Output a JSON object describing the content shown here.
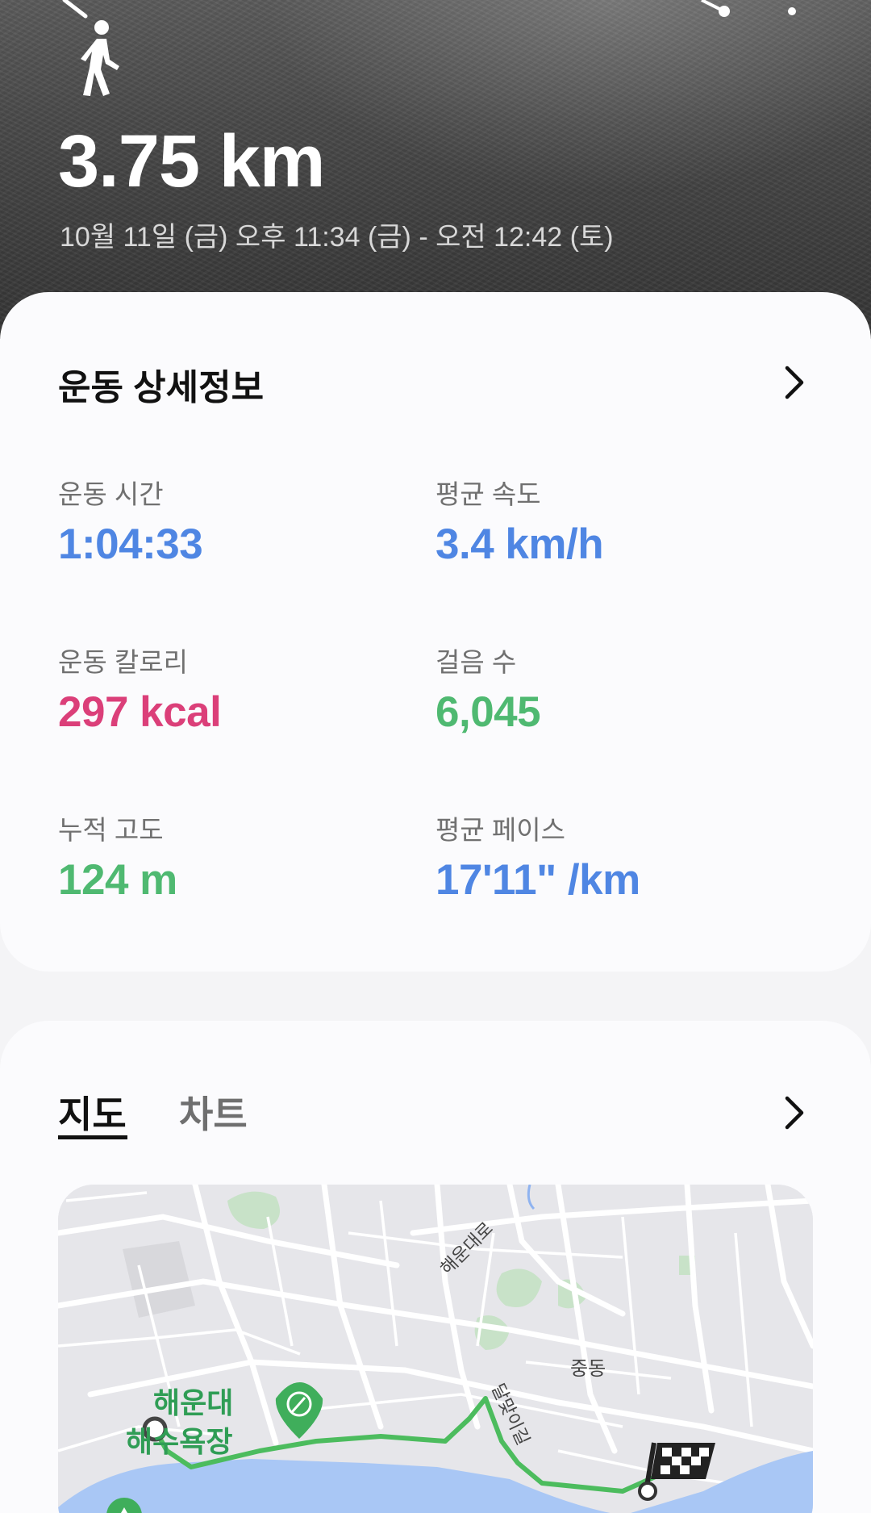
{
  "header": {
    "distance": "3.75 km",
    "datetime": "10월 11일 (금) 오후 11:34 (금) - 오전 12:42 (토)",
    "activity_icon": "walking-person-icon"
  },
  "details": {
    "title": "운동 상세정보",
    "stats": [
      {
        "label": "운동 시간",
        "value": "1:04:33",
        "color": "#4f86e3"
      },
      {
        "label": "평균 속도",
        "value": "3.4 km/h",
        "color": "#4f86e3"
      },
      {
        "label": "운동 칼로리",
        "value": "297 kcal",
        "color": "#db3f79"
      },
      {
        "label": "걸음 수",
        "value": "6,045",
        "color": "#4fb971"
      },
      {
        "label": "누적 고도",
        "value": "124 m",
        "color": "#4fb971"
      },
      {
        "label": "평균 페이스",
        "value": "17'11\" /km",
        "color": "#4f86e3"
      }
    ]
  },
  "map_section": {
    "tabs": [
      {
        "label": "지도",
        "active": true
      },
      {
        "label": "차트",
        "active": false
      }
    ],
    "map": {
      "road_label_1": "해운대로",
      "road_label_2": "달맞이길",
      "district_label": "중동",
      "poi_label_line1": "해운대",
      "poi_label_line2": "해수욕장",
      "route_color": "#4cbc5e"
    }
  }
}
